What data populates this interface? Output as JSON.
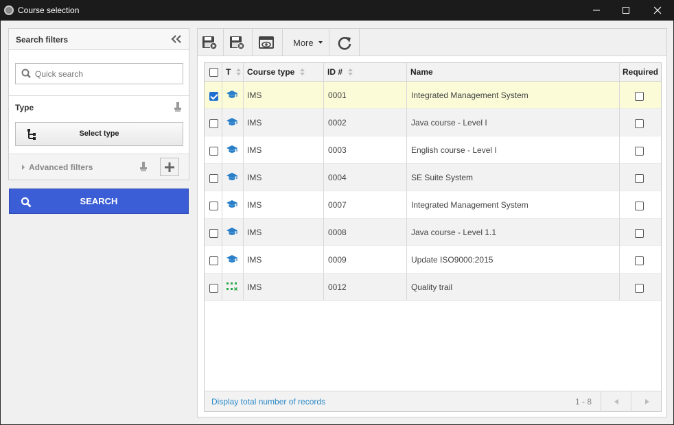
{
  "window": {
    "title": "Course selection"
  },
  "filters": {
    "header": "Search filters",
    "quick_search_placeholder": "Quick search",
    "type_label": "Type",
    "select_type_label": "Select type",
    "advanced_label": "Advanced filters",
    "search_button": "SEARCH"
  },
  "toolbar": {
    "more_label": "More"
  },
  "grid": {
    "headers": {
      "type": "T",
      "course_type": "Course type",
      "id": "ID #",
      "name": "Name",
      "required": "Required"
    },
    "rows": [
      {
        "checked": true,
        "icon": "graduation-cap-icon",
        "course_type": "IMS",
        "id": "0001",
        "name": "Integrated Management System",
        "required": false
      },
      {
        "checked": false,
        "icon": "graduation-cap-icon",
        "course_type": "IMS",
        "id": "0002",
        "name": "Java course - Level I",
        "required": false
      },
      {
        "checked": false,
        "icon": "graduation-cap-icon",
        "course_type": "IMS",
        "id": "0003",
        "name": "English course - Level I",
        "required": false
      },
      {
        "checked": false,
        "icon": "graduation-cap-icon",
        "course_type": "IMS",
        "id": "0004",
        "name": "SE Suite System",
        "required": false
      },
      {
        "checked": false,
        "icon": "graduation-cap-icon",
        "course_type": "IMS",
        "id": "0007",
        "name": "Integrated Management System",
        "required": false
      },
      {
        "checked": false,
        "icon": "graduation-cap-icon",
        "course_type": "IMS",
        "id": "0008",
        "name": "Java course - Level 1.1",
        "required": false
      },
      {
        "checked": false,
        "icon": "graduation-cap-icon",
        "course_type": "IMS",
        "id": "0009",
        "name": "Update ISO9000:2015",
        "required": false
      },
      {
        "checked": false,
        "icon": "trail-icon",
        "course_type": "IMS",
        "id": "0012",
        "name": "Quality trail",
        "required": false
      }
    ],
    "footer": {
      "total_link": "Display total number of records",
      "range": "1 - 8"
    }
  },
  "colors": {
    "accent": "#3b5ed6",
    "link": "#2d8ac7",
    "selected_row": "#fbfbd7",
    "icon_blue": "#2a7fc9",
    "icon_green": "#2aa84a"
  }
}
